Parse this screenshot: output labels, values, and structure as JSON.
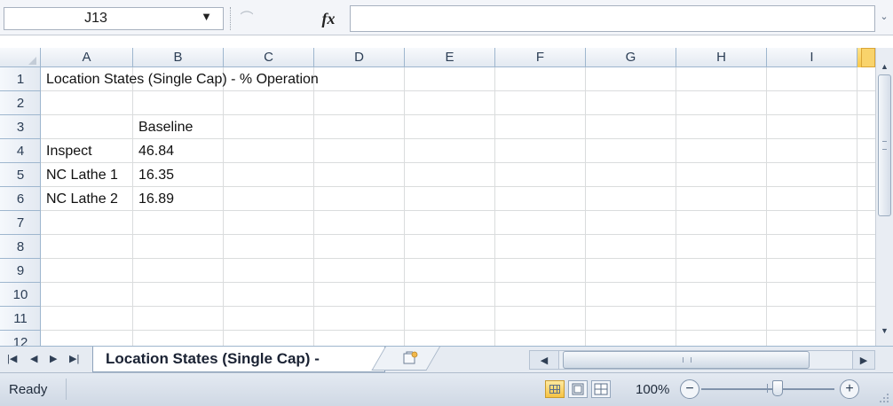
{
  "formula_bar": {
    "name_box": "J13",
    "fx_label": "fx",
    "formula": ""
  },
  "grid": {
    "column_headers": [
      "A",
      "B",
      "C",
      "D",
      "E",
      "F",
      "G",
      "H",
      "I"
    ],
    "selected_column": "J",
    "row_headers": [
      "1",
      "2",
      "3",
      "4",
      "5",
      "6",
      "7",
      "8",
      "9",
      "10",
      "11",
      "12"
    ],
    "cells": {
      "A1": "Location States (Single Cap) - % Operation",
      "B3": "Baseline",
      "A4": "Inspect",
      "B4": "46.84",
      "A5": "NC Lathe 1",
      "B5": "16.35",
      "A6": "NC Lathe 2",
      "B6": "16.89"
    }
  },
  "sheet_tabs": {
    "active": "Location States (Single Cap) -",
    "nav_icons": [
      "first-sheet-icon",
      "prev-sheet-icon",
      "next-sheet-icon",
      "last-sheet-icon"
    ],
    "new_sheet_icon": "insert-worksheet-icon"
  },
  "status_bar": {
    "status": "Ready",
    "zoom": "100%",
    "zoom_fraction": 0.5,
    "views": [
      "normal-view-icon",
      "page-layout-icon",
      "page-break-preview-icon"
    ]
  },
  "colors": {
    "header_selected": "#f8c84a",
    "gridline": "#dadcdd",
    "header_border": "#9eb6ce"
  }
}
